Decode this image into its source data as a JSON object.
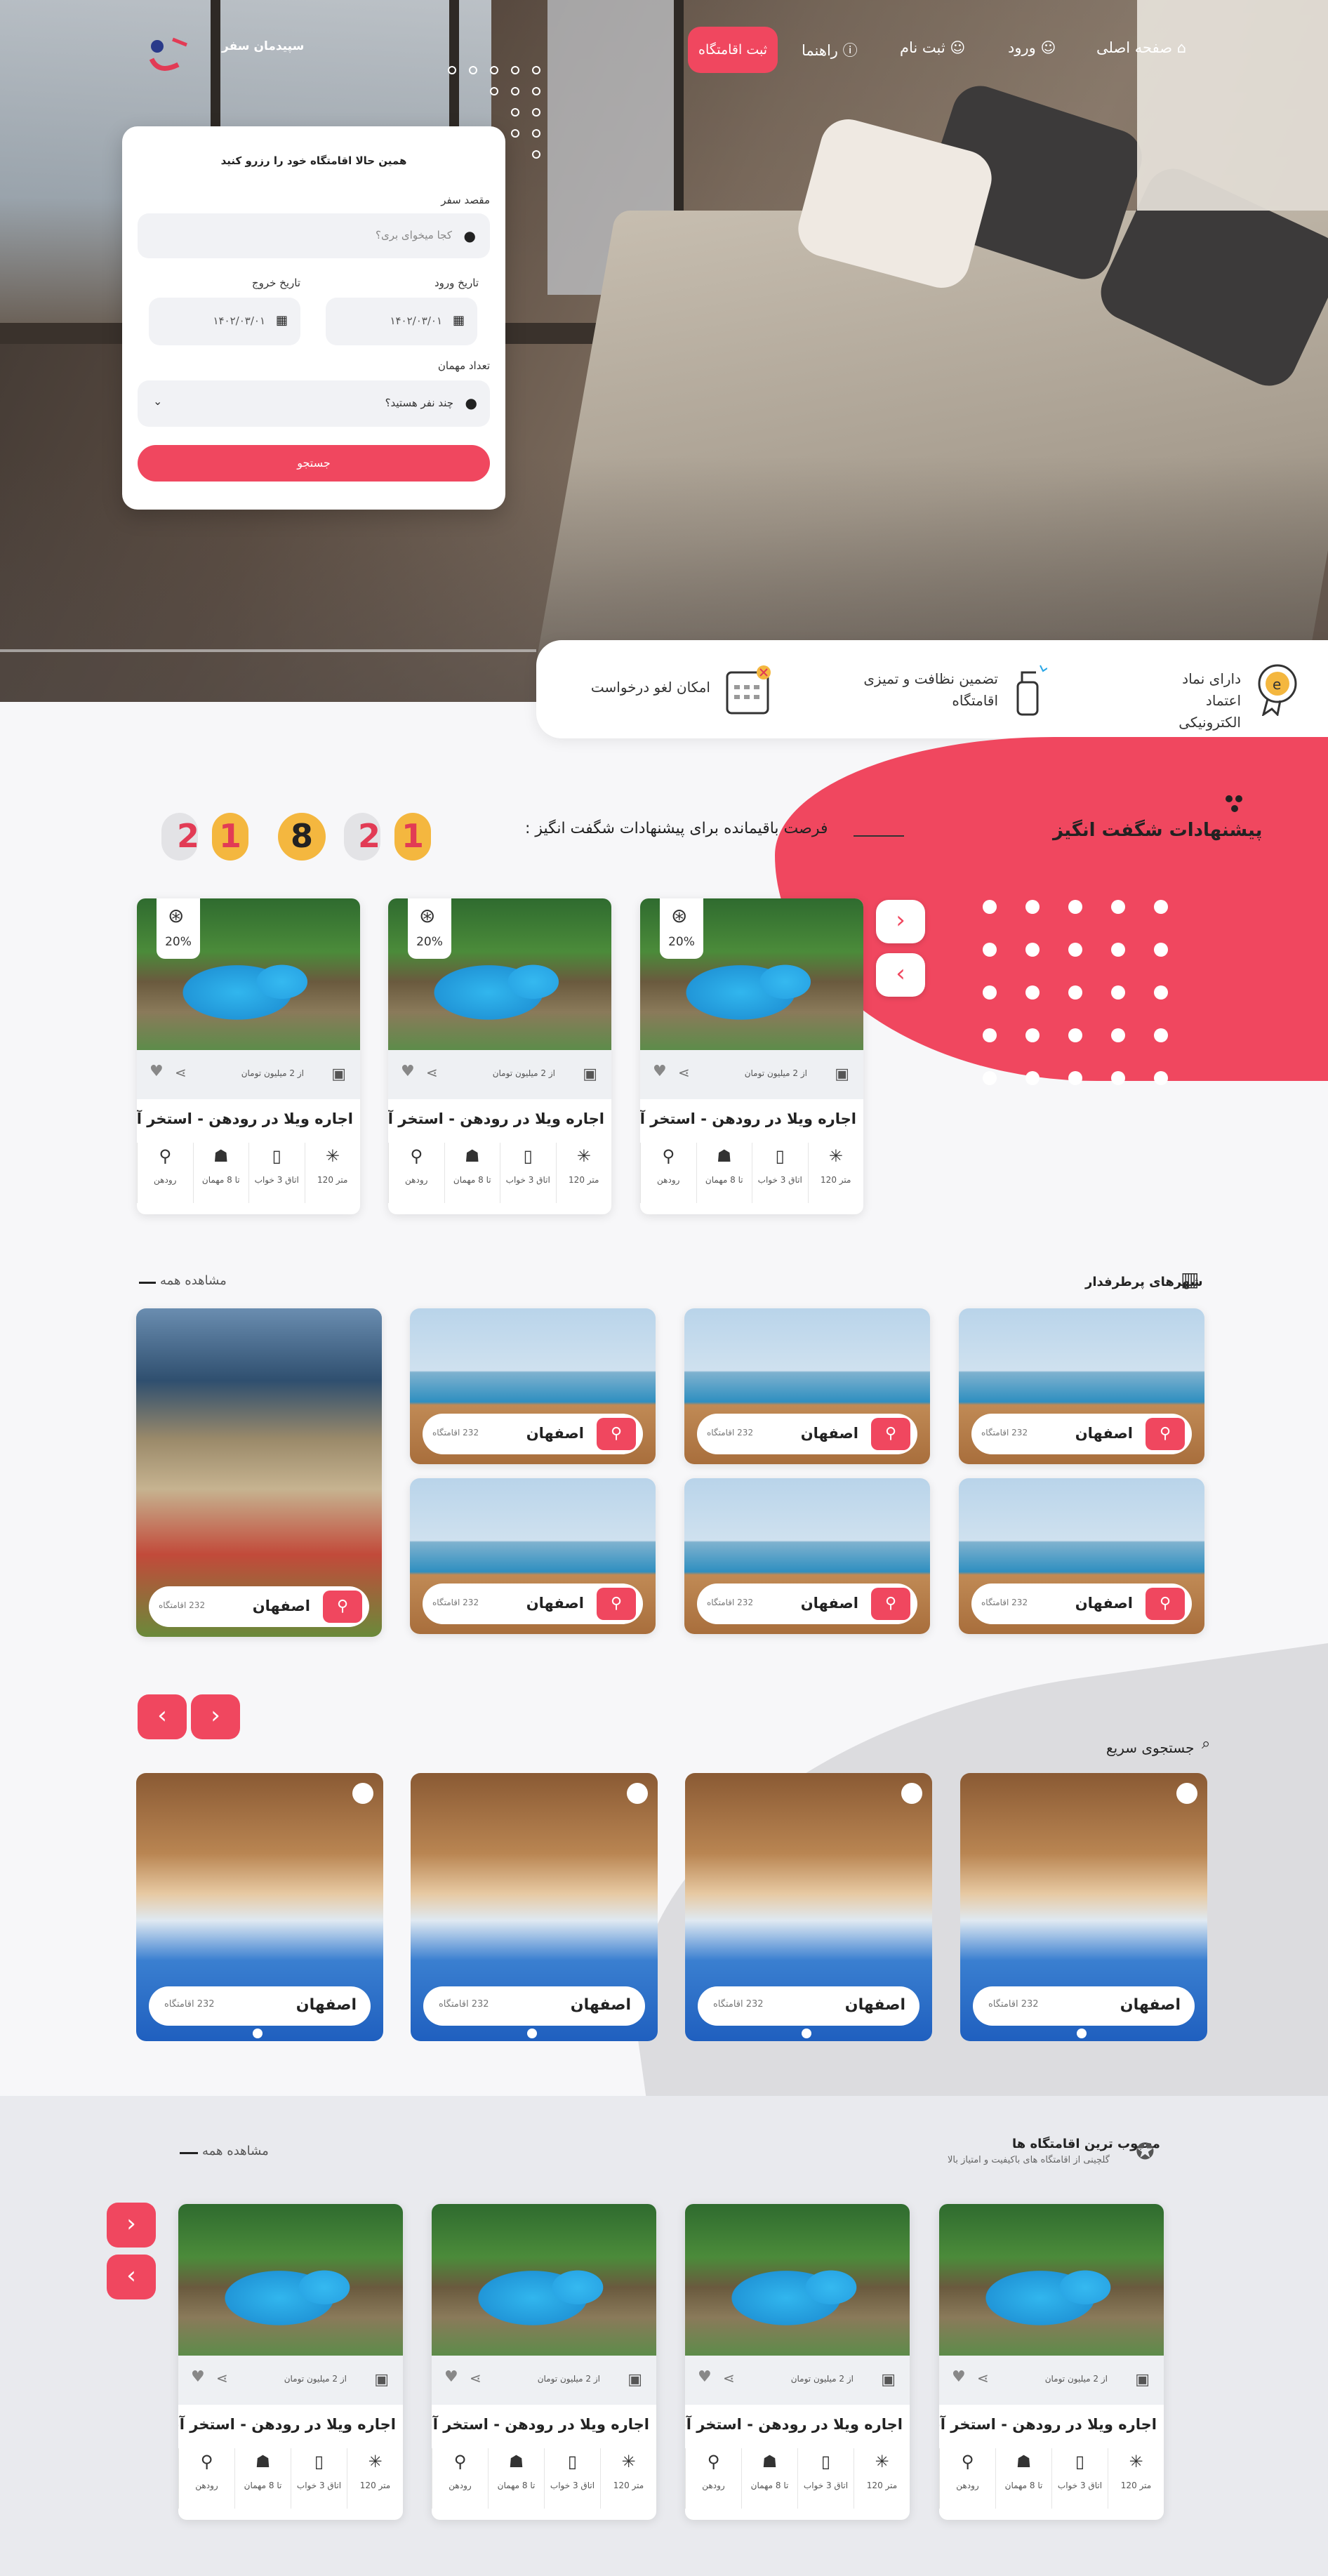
{
  "nav": {
    "brand": "سپیدمان سفر",
    "home": "صفحه اصلی",
    "login": "ورود",
    "register": "ثبت نام",
    "guide": "راهنما",
    "register_hotel": "ثبت اقامتگاه"
  },
  "search": {
    "title": "همین حالا اقامتگاه خود را رزرو کنید",
    "destination_label": "مقصد سفر",
    "destination_placeholder": "کجا میخوای بری؟",
    "checkin_label": "تاریخ ورود",
    "checkout_label": "تاریخ خروج",
    "checkin_value": "۱۴۰۲/۰۳/۰۱",
    "checkout_value": "۱۴۰۲/۰۳/۰۱",
    "guests_label": "تعداد مهمان",
    "guests_placeholder": "چند نفر هستید؟",
    "submit": "جستجو"
  },
  "features": [
    {
      "text": "دارای نماد اعتماد الکترونیکی",
      "icon": "badge-e-icon"
    },
    {
      "text": "تضمین نظافت و تمیزی اقامتگاه",
      "icon": "spray-icon"
    },
    {
      "text": "امکان لغو درخواست",
      "icon": "calendar-cancel-icon"
    }
  ],
  "offers": {
    "title": "پیشنهادات شگفت انگیز",
    "countdown_label": "فرصت باقیمانده برای پیشنهادات شگفت انگیز :",
    "countdown": [
      "2",
      "1",
      "8",
      "2",
      "1"
    ],
    "cards": [
      {
        "title": "اجاره ویلا در رودهن - استخر آب گرم",
        "price": "از 2 میلیون تومان",
        "discount": "20%",
        "features": [
          "120 متر",
          "اتاق 3 خواب",
          "تا 8 مهمان",
          "رودهن"
        ]
      },
      {
        "title": "اجاره ویلا در رودهن - استخر آب گرم",
        "price": "از 2 میلیون تومان",
        "discount": "20%",
        "features": [
          "120 متر",
          "اتاق 3 خواب",
          "تا 8 مهمان",
          "رودهن"
        ]
      },
      {
        "title": "اجاره ویلا در رودهن - استخر آب گرم",
        "price": "از 2 میلیون تومان",
        "discount": "20%",
        "features": [
          "120 متر",
          "اتاق 3 خواب",
          "تا 8 مهمان",
          "رودهن"
        ]
      }
    ]
  },
  "cities": {
    "title": "شهرهای پرطرفدار",
    "view_all": "مشاهده همه",
    "items": [
      {
        "name": "اصفهان",
        "count": "232 اقامتگاه"
      },
      {
        "name": "اصفهان",
        "count": "232 اقامتگاه"
      },
      {
        "name": "اصفهان",
        "count": "232 اقامتگاه"
      },
      {
        "name": "اصفهان",
        "count": "232 اقامتگاه"
      },
      {
        "name": "اصفهان",
        "count": "232 اقامتگاه"
      },
      {
        "name": "اصفهان",
        "count": "232 اقامتگاه"
      },
      {
        "name": "اصفهان",
        "count": "232 اقامتگاه"
      }
    ]
  },
  "quick": {
    "title": "جستجوی سریع",
    "items": [
      {
        "name": "اصفهان",
        "count": "232 اقامتگاه"
      },
      {
        "name": "اصفهان",
        "count": "232 اقامتگاه"
      },
      {
        "name": "اصفهان",
        "count": "232 اقامتگاه"
      },
      {
        "name": "اصفهان",
        "count": "232 اقامتگاه"
      }
    ]
  },
  "popular": {
    "title": "محبوب ترین اقامتگاه ها",
    "subtitle": "گلچینی از اقامتگاه های باکیفیت و امتیاز بالا",
    "view_all": "مشاهده همه",
    "cards": [
      {
        "title": "اجاره ویلا در رودهن - استخر آب گرم",
        "price": "از 2 میلیون تومان",
        "features": [
          "120 متر",
          "اتاق 3 خواب",
          "تا 8 مهمان",
          "رودهن"
        ]
      },
      {
        "title": "اجاره ویلا در رودهن - استخر آب گرم",
        "price": "از 2 میلیون تومان",
        "features": [
          "120 متر",
          "اتاق 3 خواب",
          "تا 8 مهمان",
          "رودهن"
        ]
      },
      {
        "title": "اجاره ویلا در رودهن - استخر آب گرم",
        "price": "از 2 میلیون تومان",
        "features": [
          "120 متر",
          "اتاق 3 خواب",
          "تا 8 مهمان",
          "رودهن"
        ]
      },
      {
        "title": "اجاره ویلا در رودهن - استخر آب گرم",
        "price": "از 2 میلیون تومان",
        "features": [
          "120 متر",
          "اتاق 3 خواب",
          "تا 8 مهمان",
          "رودهن"
        ]
      }
    ]
  },
  "colors": {
    "accent": "#f0475f",
    "countdown": "#f4b73f"
  }
}
